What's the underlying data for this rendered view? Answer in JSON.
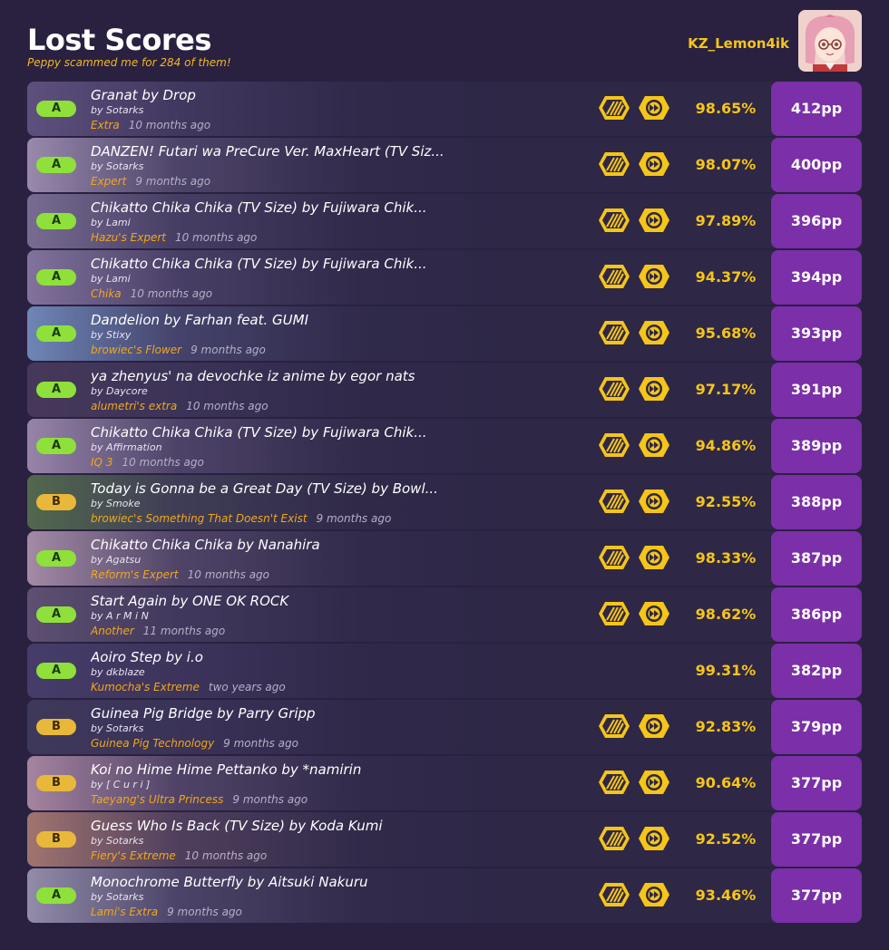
{
  "header": {
    "title": "Lost Scores",
    "subtitle": "Peppy scammed me for 284 of them!",
    "username": "KZ_Lemon4ik"
  },
  "colors": {
    "background": "#2a2140",
    "accent_yellow": "#f5c518",
    "difficulty_orange": "#f2a71b",
    "pp_purple": "#7b2fa8",
    "grade_a": "#8fe03a",
    "grade_b": "#e8b83a"
  },
  "scores": [
    {
      "grade": "A",
      "song": "Granat by Drop",
      "mapper": "by Sotarks",
      "difficulty": "Extra",
      "ago": "10 months ago",
      "mods": [
        "hr-icon",
        "dt-icon"
      ],
      "accuracy": "98.65%",
      "pp": "412pp",
      "bg": "#6a5a8a"
    },
    {
      "grade": "A",
      "song": "DANZEN! Futari wa PreCure Ver. MaxHeart (TV Siz...",
      "mapper": "by Sotarks",
      "difficulty": "Expert",
      "ago": "9 months ago",
      "mods": [
        "hr-icon",
        "dt-icon"
      ],
      "accuracy": "98.07%",
      "pp": "400pp",
      "bg": "#b9a6c9"
    },
    {
      "grade": "A",
      "song": "Chikatto Chika Chika (TV Size) by Fujiwara Chik...",
      "mapper": "by Lami",
      "difficulty": "Hazu's Expert",
      "ago": "10 months ago",
      "mods": [
        "hr-icon",
        "dt-icon"
      ],
      "accuracy": "97.89%",
      "pp": "396pp",
      "bg": "#8d7fa5"
    },
    {
      "grade": "A",
      "song": "Chikatto Chika Chika (TV Size) by Fujiwara Chik...",
      "mapper": "by Lami",
      "difficulty": "Chika",
      "ago": "10 months ago",
      "mods": [
        "hr-icon",
        "dt-icon"
      ],
      "accuracy": "94.37%",
      "pp": "394pp",
      "bg": "#9a88b3"
    },
    {
      "grade": "A",
      "song": "Dandelion by Farhan feat. GUMI",
      "mapper": "by Stixy",
      "difficulty": "browiec's Flower",
      "ago": "9 months ago",
      "mods": [
        "hr-icon",
        "dt-icon"
      ],
      "accuracy": "95.68%",
      "pp": "393pp",
      "bg": "#7fa2d6"
    },
    {
      "grade": "A",
      "song": "ya zhenyus' na devochke iz anime by egor nats",
      "mapper": "by Daycore",
      "difficulty": "alumetri's extra",
      "ago": "10 months ago",
      "mods": [
        "hr-icon",
        "dt-icon"
      ],
      "accuracy": "97.17%",
      "pp": "391pp",
      "bg": "#4a3a5a"
    },
    {
      "grade": "A",
      "song": "Chikatto Chika Chika (TV Size) by Fujiwara Chik...",
      "mapper": "by Affirmation",
      "difficulty": "IQ 3",
      "ago": "10 months ago",
      "mods": [
        "hr-icon",
        "dt-icon"
      ],
      "accuracy": "94.86%",
      "pp": "389pp",
      "bg": "#b7a0c4"
    },
    {
      "grade": "B",
      "song": "Today is Gonna be a Great Day (TV Size) by Bowl...",
      "mapper": "by Smoke",
      "difficulty": "browiec's Something That Doesn't Exist",
      "ago": "9 months ago",
      "mods": [
        "hr-icon",
        "dt-icon"
      ],
      "accuracy": "92.55%",
      "pp": "388pp",
      "bg": "#5a7a4a"
    },
    {
      "grade": "A",
      "song": "Chikatto Chika Chika by Nanahira",
      "mapper": "by Agatsu",
      "difficulty": "Reform's Expert",
      "ago": "10 months ago",
      "mods": [
        "hr-icon",
        "dt-icon"
      ],
      "accuracy": "98.33%",
      "pp": "387pp",
      "bg": "#c7a8c0"
    },
    {
      "grade": "A",
      "song": "Start Again by ONE OK ROCK",
      "mapper": "by A r M i N",
      "difficulty": "Another",
      "ago": "11 months ago",
      "mods": [
        "hr-icon",
        "dt-icon"
      ],
      "accuracy": "98.62%",
      "pp": "386pp",
      "bg": "#6a5a7a"
    },
    {
      "grade": "A",
      "song": "Aoiro Step by i.o",
      "mapper": "by dkblaze",
      "difficulty": "Kumocha's Extreme",
      "ago": "two years ago",
      "mods": [],
      "accuracy": "99.31%",
      "pp": "382pp",
      "bg": "#4a4070"
    },
    {
      "grade": "B",
      "song": "Guinea Pig Bridge by Parry Gripp",
      "mapper": "by Sotarks",
      "difficulty": "Guinea Pig Technology",
      "ago": "9 months ago",
      "mods": [
        "hr-icon",
        "dt-icon"
      ],
      "accuracy": "92.83%",
      "pp": "379pp",
      "bg": "#3f3a5c"
    },
    {
      "grade": "B",
      "song": "Koi no Hime Hime Pettanko by *namirin",
      "mapper": "by [ C u r i ]",
      "difficulty": "Taeyang's Ultra Princess",
      "ago": "9 months ago",
      "mods": [
        "hr-icon",
        "dt-icon"
      ],
      "accuracy": "90.64%",
      "pp": "377pp",
      "bg": "#c9a0b8"
    },
    {
      "grade": "B",
      "song": "Guess Who Is Back (TV Size) by Koda Kumi",
      "mapper": "by Sotarks",
      "difficulty": "Fiery's Extreme",
      "ago": "10 months ago",
      "mods": [
        "hr-icon",
        "dt-icon"
      ],
      "accuracy": "92.52%",
      "pp": "377pp",
      "bg": "#c48a78"
    },
    {
      "grade": "A",
      "song": "Monochrome Butterfly by Aitsuki Nakuru",
      "mapper": "by Sotarks",
      "difficulty": "Lami's Extra",
      "ago": "9 months ago",
      "mods": [
        "hr-icon",
        "dt-icon"
      ],
      "accuracy": "93.46%",
      "pp": "377pp",
      "bg": "#b0aac4"
    }
  ]
}
